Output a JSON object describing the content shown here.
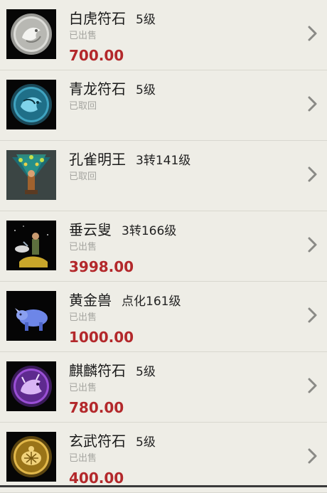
{
  "items": [
    {
      "name": "白虎符石",
      "level": "5级",
      "status": "已出售",
      "price": "700.00",
      "icon": "white-tiger-rune-icon"
    },
    {
      "name": "青龙符石",
      "level": "5级",
      "status": "已取回",
      "price": "",
      "icon": "azure-dragon-rune-icon"
    },
    {
      "name": "孔雀明王",
      "level": "3转141级",
      "status": "已取回",
      "price": "",
      "icon": "peacock-king-character-icon"
    },
    {
      "name": "垂云叟",
      "level": "3转166级",
      "status": "已出售",
      "price": "3998.00",
      "icon": "cloud-elder-character-icon"
    },
    {
      "name": "黄金兽",
      "level": "点化161级",
      "status": "已出售",
      "price": "1000.00",
      "icon": "golden-beast-pet-icon"
    },
    {
      "name": "麒麟符石",
      "level": "5级",
      "status": "已出售",
      "price": "780.00",
      "icon": "qilin-rune-icon"
    },
    {
      "name": "玄武符石",
      "level": "5级",
      "status": "已出售",
      "price": "400.00",
      "icon": "black-tortoise-rune-icon"
    }
  ],
  "colors": {
    "background": "#eeede6",
    "price": "#b3282b",
    "status": "#a5a5a0",
    "divider": "#d8d7cf"
  }
}
